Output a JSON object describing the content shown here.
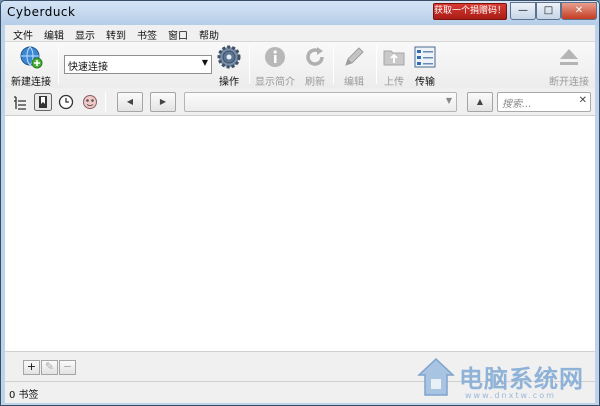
{
  "window": {
    "title": "Cyberduck",
    "promo_label": "获取一个捐赠码！",
    "min_glyph": "—",
    "max_glyph": "□",
    "close_glyph": "✕"
  },
  "menu": [
    "文件",
    "编辑",
    "显示",
    "转到",
    "书签",
    "窗口",
    "帮助"
  ],
  "toolbar": {
    "new_connection": "新建连接",
    "quick_connect": "快速连接",
    "action": "操作",
    "info": "显示简介",
    "refresh": "刷新",
    "edit": "编辑",
    "upload": "上传",
    "transfers": "传输",
    "disconnect": "断开连接"
  },
  "navbar": {
    "search_placeholder": "搜索...",
    "back_glyph": "◀",
    "forward_glyph": "▶",
    "up_glyph": "▲",
    "clear_glyph": "✕"
  },
  "bookmark_tools": {
    "add": "+",
    "edit": "✎",
    "remove": "−"
  },
  "status": {
    "bookmark_count": "0 书签"
  },
  "watermark": {
    "text": "电脑系统网",
    "url": "www.dnxtw.com"
  },
  "colors": {
    "promo": "#c0272d",
    "close": "#c43b21",
    "accent": "#2f6db5"
  }
}
